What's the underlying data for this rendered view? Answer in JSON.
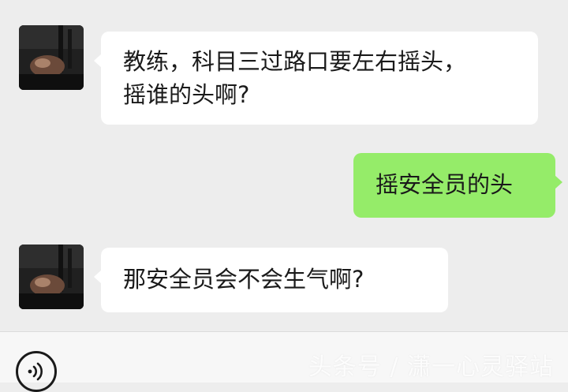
{
  "messages": [
    {
      "side": "in",
      "lines": [
        "教练，科目三过路口要左右摇头，",
        "摇谁的头啊?"
      ]
    },
    {
      "side": "out",
      "lines": [
        "摇安全员的头"
      ]
    },
    {
      "side": "in",
      "lines": [
        "那安全员会不会生气啊?"
      ]
    }
  ],
  "input_bar": {
    "voice_icon": "voice-icon"
  },
  "watermark": "头条号 / 潇一心灵驿站",
  "colors": {
    "background": "#ededed",
    "incoming_bubble": "#ffffff",
    "outgoing_bubble": "#95ec69",
    "text": "#1a1a1a"
  }
}
